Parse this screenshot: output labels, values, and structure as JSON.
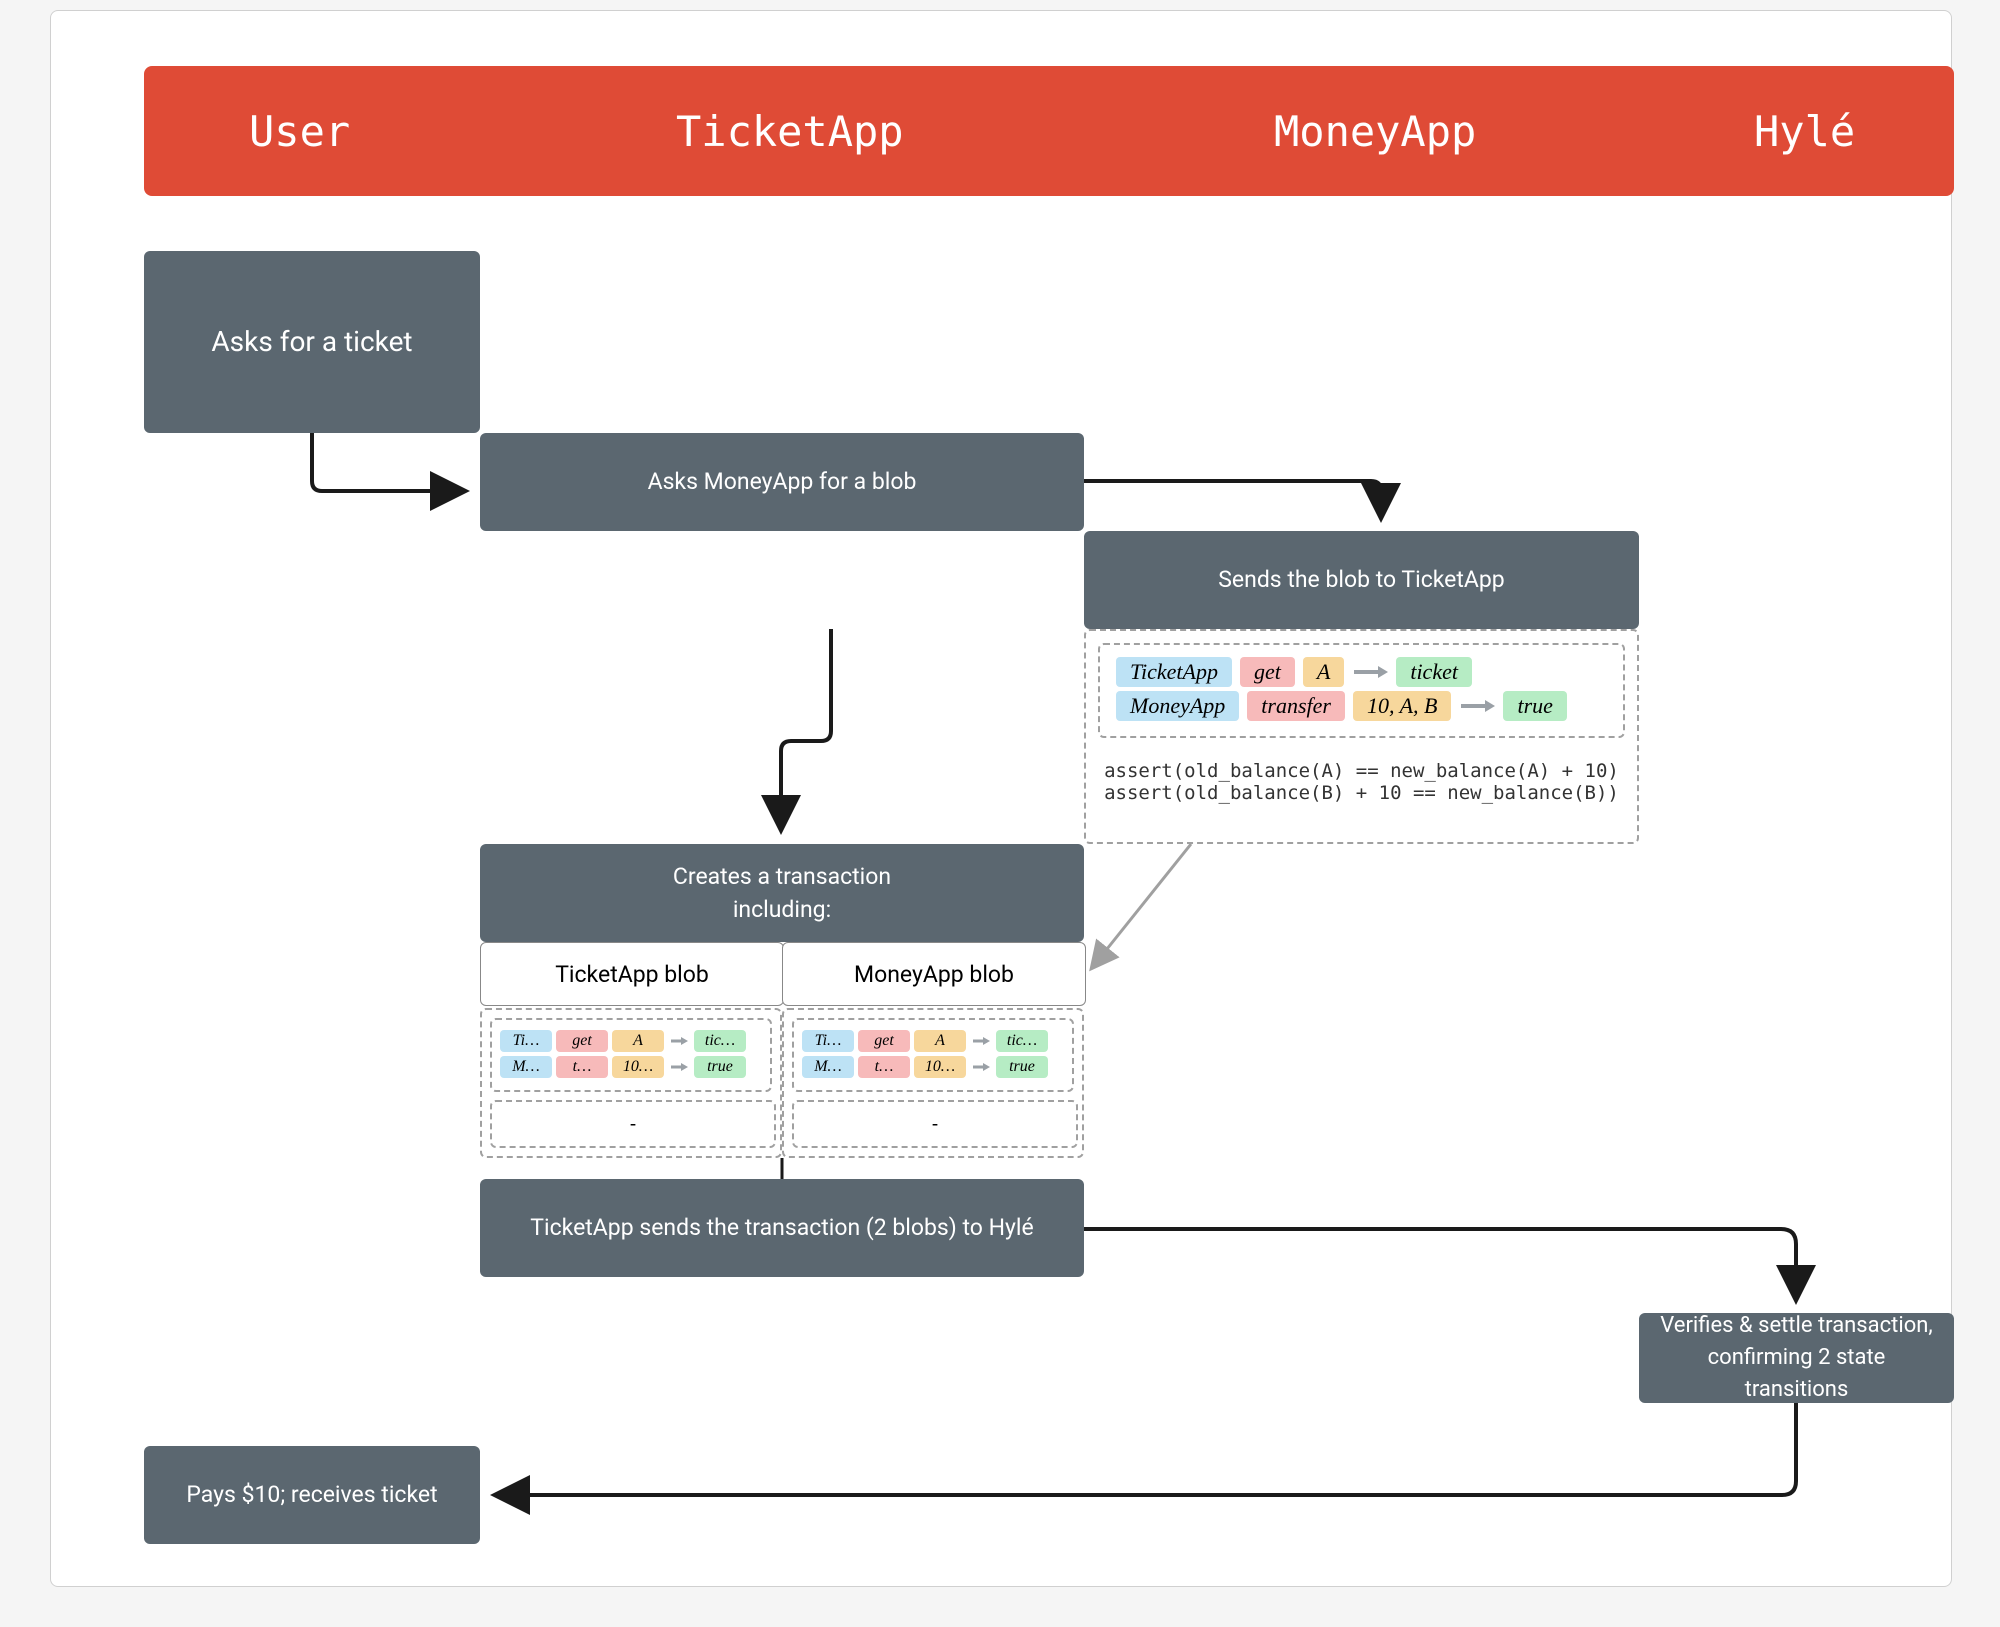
{
  "header": {
    "user": "User",
    "ticketapp": "TicketApp",
    "moneyapp": "MoneyApp",
    "hyle": "Hylé"
  },
  "steps": {
    "ask": "Asks for a ticket",
    "askBlob": "Asks MoneyApp for a blob",
    "sendBlob": "Sends the blob to TicketApp",
    "create_l1": "Creates a transaction",
    "create_l2": "including:",
    "ticketBlob": "TicketApp blob",
    "moneyBlob": "MoneyApp blob",
    "sendTx": "TicketApp sends the transaction (2 blobs) to Hylé",
    "verify_l1": "Verifies & settle transaction,",
    "verify_l2": "confirming 2 state transitions",
    "pays": "Pays $10; receives ticket"
  },
  "blob": {
    "r1": {
      "a": "TicketApp",
      "b": "get",
      "c": "A",
      "d": "ticket"
    },
    "r2": {
      "a": "MoneyApp",
      "b": "transfer",
      "c": "10, A, B",
      "d": "true"
    },
    "assert1": "assert(old_balance(A) == new_balance(A) + 10)",
    "assert2": "assert(old_balance(B) + 10 == new_balance(B))"
  },
  "miniBlob": {
    "r1": {
      "a": "Ti…",
      "b": "get",
      "c": "A",
      "d": "tic…"
    },
    "r2": {
      "a": "M…",
      "b": "t…",
      "c": "10…",
      "d": "true"
    },
    "dash": "-"
  }
}
